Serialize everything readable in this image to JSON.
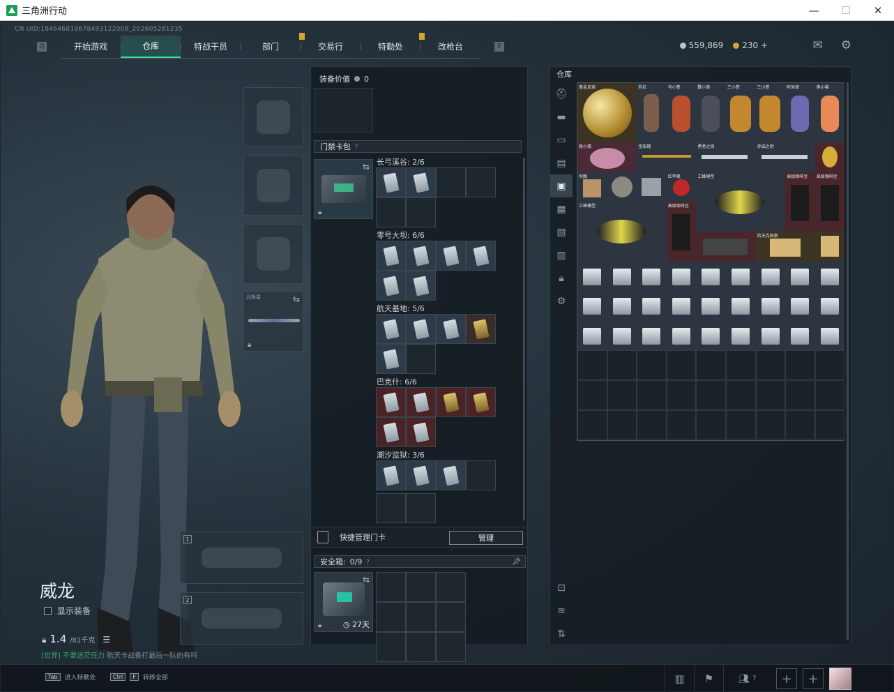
{
  "window": {
    "title": "三角洲行动",
    "minimize": "—",
    "maximize": "☐",
    "close": "✕"
  },
  "uid": "CN UID:184646819678493122008_202605281235",
  "nav": {
    "tabs": [
      {
        "label": "开始游戏"
      },
      {
        "label": "仓库"
      },
      {
        "label": "特战干员"
      },
      {
        "label": "部门"
      },
      {
        "label": "交易行"
      },
      {
        "label": "特勤处"
      },
      {
        "label": "改枪台"
      }
    ],
    "active_tab": "仓库",
    "left_key": "Q",
    "right_key": "E"
  },
  "currency": {
    "primary": "559,869",
    "secondary": "230",
    "secondary_add": "+"
  },
  "character": {
    "name": "威龙",
    "show_equipment": "显示装备",
    "weight_value": "1.4",
    "weight_max": "/81千克",
    "chat_channel": "[世界] 不要迷茫任力",
    "chat_text": "航天卡战备打最后一队的有吗"
  },
  "slots": {
    "melee_label": "北极星",
    "weapon1_num": "1",
    "weapon2_num": "2"
  },
  "middle": {
    "equip_value_label": "装备价值",
    "equip_value": "0",
    "keycard_bag_label": "门禁卡包",
    "groups": [
      {
        "title": "长弓溪谷: 2/6"
      },
      {
        "title": "零号大坝: 6/6"
      },
      {
        "title": "航天基地: 5/6"
      },
      {
        "title": "巴克什: 6/6"
      },
      {
        "title": "潮汐监狱: 3/6"
      }
    ],
    "quick_manage_label": "快捷管理门卡",
    "manage_button": "管理",
    "safe_box_label": "安全箱:",
    "safe_box_count": "0/9",
    "safe_box_days": "27天"
  },
  "warehouse": {
    "title": "仓库",
    "item_labels": {
      "gold_football": "黄金足球",
      "lara": "劳拉",
      "redcup": "马小萱",
      "figure2": "戴小美",
      "sombrero1": "三小萱",
      "sombrero2": "三小萱",
      "bunny": "阿米娅",
      "cat": "奥小喵",
      "bunny_egg": "兔小蛋",
      "gold_rose": "金玫瑰",
      "key1": "勇者之钥",
      "key2": "赤诚之钥",
      "map": "坝图",
      "apple": "红苹果",
      "wasp1": "工蜂模型",
      "coffee": "高级咖啡豆",
      "wasp2": "工蜂模型",
      "ticket": "哈夫克档案"
    }
  },
  "bottom": {
    "hint1_key": "Tab",
    "hint1_text": "进入特勤处",
    "hint2_key1": "Ctrl",
    "hint2_key2": "F",
    "hint2_text": "转移全部",
    "friends_count": "7"
  }
}
